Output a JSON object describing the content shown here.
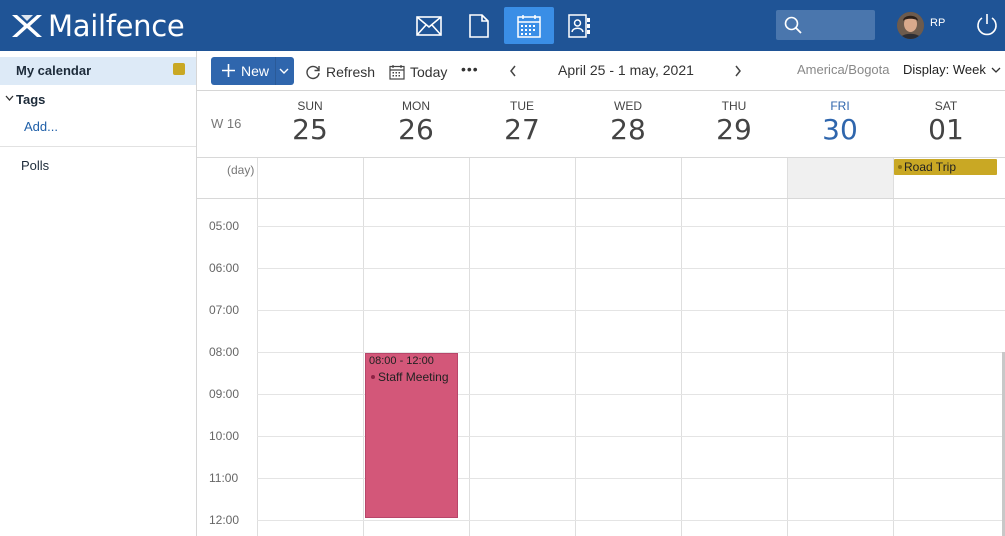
{
  "app": {
    "name": "Mailfence",
    "user_initials": "RP"
  },
  "topnav": {
    "icons": [
      "mail-icon",
      "documents-icon",
      "calendar-icon",
      "contacts-icon"
    ],
    "active": "calendar-icon",
    "search_placeholder": ""
  },
  "sidebar": {
    "calendar_label": "My calendar",
    "calendar_color": "#c9a824",
    "tags_label": "Tags",
    "add_label": "Add...",
    "polls_label": "Polls"
  },
  "toolbar": {
    "new_label": "New",
    "refresh_label": "Refresh",
    "today_label": "Today",
    "more_label": "•••",
    "date_range": "April 25 - 1 may, 2021",
    "timezone": "America/Bogota",
    "display_label": "Display: Week"
  },
  "calendar": {
    "week_label": "W 16",
    "allday_label": "(day)",
    "days": [
      {
        "name": "SUN",
        "date": "25"
      },
      {
        "name": "MON",
        "date": "26"
      },
      {
        "name": "TUE",
        "date": "27"
      },
      {
        "name": "WED",
        "date": "28"
      },
      {
        "name": "THU",
        "date": "29"
      },
      {
        "name": "FRI",
        "date": "30"
      },
      {
        "name": "SAT",
        "date": "01"
      }
    ],
    "today_index": 5,
    "hours": [
      "05:00",
      "06:00",
      "07:00",
      "08:00",
      "09:00",
      "10:00",
      "11:00",
      "12:00"
    ],
    "events": {
      "allday": {
        "title": "Road Trip",
        "day": "SAT",
        "color": "#c9a824"
      },
      "timed": {
        "time": "08:00 - 12:00",
        "title": "Staff Meeting",
        "day": "MON",
        "color": "#d35779"
      }
    }
  }
}
